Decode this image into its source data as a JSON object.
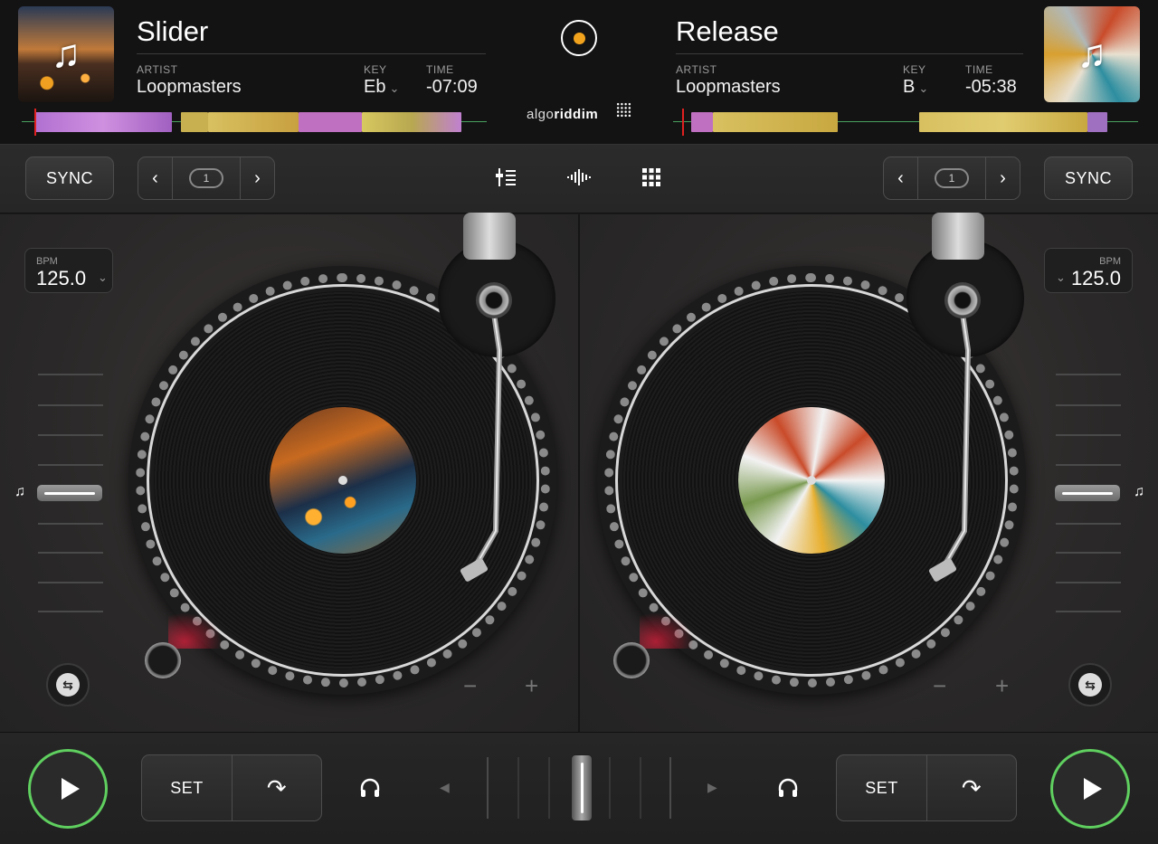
{
  "deck_a": {
    "title": "Slider",
    "artist_label": "ARTIST",
    "artist": "Loopmasters",
    "key_label": "KEY",
    "key": "Eb",
    "time_label": "TIME",
    "time": "-07:09",
    "sync_label": "SYNC",
    "loop_count": "1",
    "bpm_label": "BPM",
    "bpm": "125.0",
    "cue_label": "SET"
  },
  "deck_b": {
    "title": "Release",
    "artist_label": "ARTIST",
    "artist": "Loopmasters",
    "key_label": "KEY",
    "key": "B",
    "time_label": "TIME",
    "time": "-05:38",
    "sync_label": "SYNC",
    "loop_count": "1",
    "bpm_label": "BPM",
    "bpm": "125.0",
    "cue_label": "SET"
  },
  "branding": {
    "logo_prefix": "algo",
    "logo_bold": "riddim"
  },
  "glyphs": {
    "note": "♫",
    "chevron_down": "⌄",
    "arrow_left": "‹",
    "arrow_right": "›",
    "minus": "−",
    "plus": "+",
    "headphones": "🎧",
    "cue_jump": "↷",
    "xfader_left": "◀",
    "xfader_right": "▶"
  },
  "colors": {
    "accent_record": "#f2a31d",
    "play_ring": "#5fcf5f",
    "playhead": "#e02020"
  }
}
